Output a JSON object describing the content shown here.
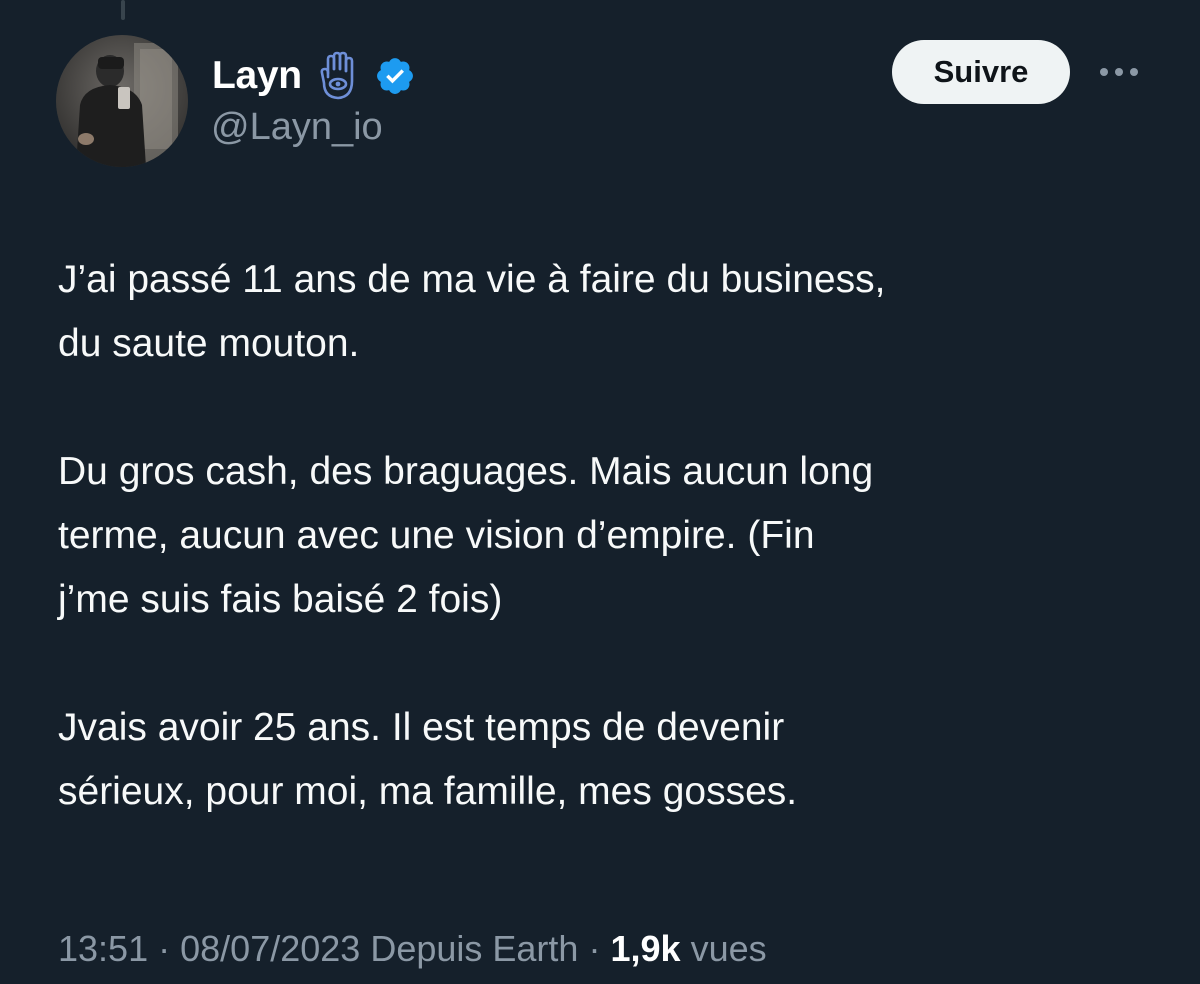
{
  "author": {
    "display_name": "Layn",
    "handle": "@Layn_io",
    "verified": true
  },
  "actions": {
    "follow_label": "Suivre"
  },
  "tweet": {
    "paragraphs": [
      [
        "J’ai passé 11 ans de ma vie à faire du business,",
        "du saute mouton."
      ],
      [
        "Du gros cash, des braguages. Mais aucun long",
        "terme, aucun avec une vision d’empire. (Fin",
        "j’me suis fais baisé 2 fois)"
      ],
      [
        "Jvais avoir 25 ans. Il est temps de devenir",
        "sérieux, pour moi, ma famille, mes gosses."
      ]
    ]
  },
  "meta": {
    "time": "13:51",
    "separator": "·",
    "date": "08/07/2023",
    "source": "Depuis Earth",
    "views_count": "1,9k",
    "views_label": "vues"
  },
  "icons": {
    "hamsa": "hamsa-icon",
    "verified": "verified-badge-icon",
    "more": "more-options-icon"
  },
  "colors": {
    "background": "#15202b",
    "text": "#f7f9f9",
    "secondary_text": "#8b98a5",
    "verified_blue": "#1d9bf0",
    "hamsa_blue": "#6e8fd8",
    "follow_button_bg": "#eff3f4"
  }
}
